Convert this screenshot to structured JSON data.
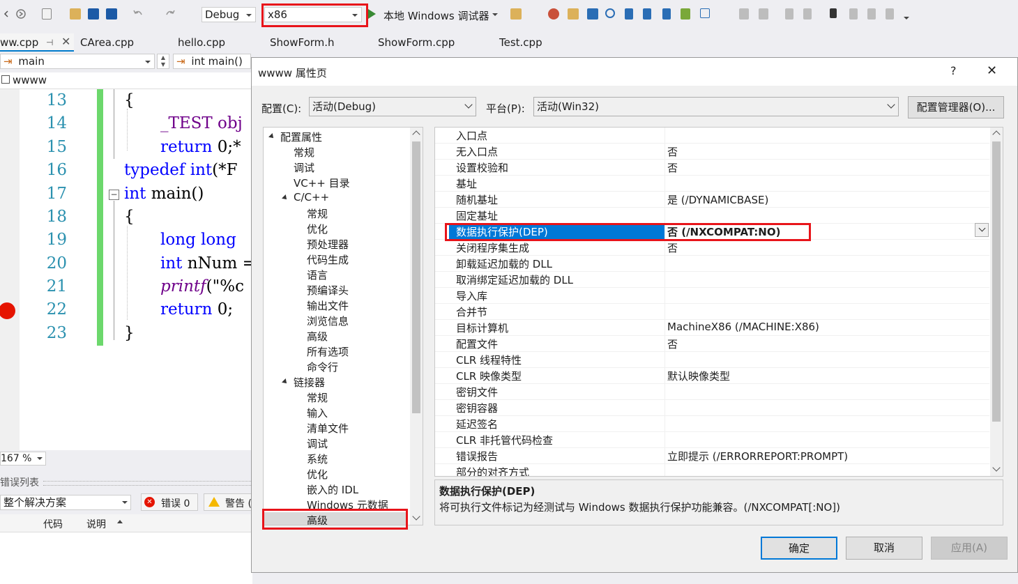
{
  "toolbar": {
    "config_value": "Debug",
    "platform_value": "x86",
    "debugger_label": "本地 Windows 调试器"
  },
  "tabs": [
    "ww.cpp",
    "CArea.cpp",
    "hello.cpp",
    "ShowForm.h",
    "ShowForm.cpp",
    "Test.cpp"
  ],
  "navbar": {
    "scope": "main",
    "member": "int main()"
  },
  "project_label": "wwww",
  "editor": {
    "line_numbers": [
      "13",
      "14",
      "15",
      "16",
      "17",
      "18",
      "19",
      "20",
      "21",
      "22",
      "23"
    ],
    "lines": {
      "l13": "{",
      "l14": "_TEST obj",
      "l15a": "return ",
      "l15b": "0;*",
      "l16a": "typedef ",
      "l16b": "int",
      "l16c": "(*F",
      "l17a": "int ",
      "l17b": "main()",
      "l18": "{",
      "l19": "long long",
      "l20a": "int ",
      "l20b": "nNum =",
      "l21a": "printf",
      "l21b": "(\"%c",
      "l22a": "return ",
      "l22b": "0;",
      "l23": "}"
    },
    "zoom": "167 %"
  },
  "error_list": {
    "title": "错误列表",
    "scope": "整个解决方案",
    "errors_label": "错误 0",
    "warnings_label": "警告 (",
    "col_code": "代码",
    "col_desc": "说明"
  },
  "dialog": {
    "title": "wwww 属性页",
    "help": "?",
    "config_label": "配置(C):",
    "config_value": "活动(Debug)",
    "platform_label": "平台(P):",
    "platform_value": "活动(Win32)",
    "config_manager": "配置管理器(O)...",
    "tree": [
      {
        "label": "配置属性",
        "level": 0,
        "expanded": true
      },
      {
        "label": "常规",
        "level": 1
      },
      {
        "label": "调试",
        "level": 1
      },
      {
        "label": "VC++ 目录",
        "level": 1
      },
      {
        "label": "C/C++",
        "level": 1,
        "expanded": true
      },
      {
        "label": "常规",
        "level": 2
      },
      {
        "label": "优化",
        "level": 2
      },
      {
        "label": "预处理器",
        "level": 2
      },
      {
        "label": "代码生成",
        "level": 2
      },
      {
        "label": "语言",
        "level": 2
      },
      {
        "label": "预编译头",
        "level": 2
      },
      {
        "label": "输出文件",
        "level": 2
      },
      {
        "label": "浏览信息",
        "level": 2
      },
      {
        "label": "高级",
        "level": 2
      },
      {
        "label": "所有选项",
        "level": 2
      },
      {
        "label": "命令行",
        "level": 2
      },
      {
        "label": "链接器",
        "level": 1,
        "expanded": true
      },
      {
        "label": "常规",
        "level": 2
      },
      {
        "label": "输入",
        "level": 2
      },
      {
        "label": "清单文件",
        "level": 2
      },
      {
        "label": "调试",
        "level": 2
      },
      {
        "label": "系统",
        "level": 2
      },
      {
        "label": "优化",
        "level": 2
      },
      {
        "label": "嵌入的 IDL",
        "level": 2
      },
      {
        "label": "Windows 元数据",
        "level": 2
      },
      {
        "label": "高级",
        "level": 2,
        "selected": true
      }
    ],
    "properties": [
      {
        "name": "入口点",
        "value": ""
      },
      {
        "name": "无入口点",
        "value": "否"
      },
      {
        "name": "设置校验和",
        "value": "否"
      },
      {
        "name": "基址",
        "value": ""
      },
      {
        "name": "随机基址",
        "value": "是 (/DYNAMICBASE)"
      },
      {
        "name": "固定基址",
        "value": ""
      },
      {
        "name": "数据执行保护(DEP)",
        "value": "否 (/NXCOMPAT:NO)",
        "selected": true
      },
      {
        "name": "关闭程序集生成",
        "value": "否"
      },
      {
        "name": "卸载延迟加载的 DLL",
        "value": ""
      },
      {
        "name": "取消绑定延迟加载的 DLL",
        "value": ""
      },
      {
        "name": "导入库",
        "value": ""
      },
      {
        "name": "合并节",
        "value": ""
      },
      {
        "name": "目标计算机",
        "value": "MachineX86 (/MACHINE:X86)"
      },
      {
        "name": "配置文件",
        "value": "否"
      },
      {
        "name": "CLR 线程特性",
        "value": ""
      },
      {
        "name": "CLR 映像类型",
        "value": "默认映像类型"
      },
      {
        "name": "密钥文件",
        "value": ""
      },
      {
        "name": "密钥容器",
        "value": ""
      },
      {
        "name": "延迟签名",
        "value": ""
      },
      {
        "name": "CLR 非托管代码检查",
        "value": ""
      },
      {
        "name": "错误报告",
        "value": "立即提示 (/ERRORREPORT:PROMPT)"
      },
      {
        "name": "部分的对齐方式",
        "value": ""
      }
    ],
    "desc_title": "数据执行保护(DEP)",
    "desc_text": "将可执行文件标记为经测试与 Windows 数据执行保护功能兼容。(/NXCOMPAT[:NO])",
    "ok": "确定",
    "cancel": "取消",
    "apply": "应用(A)"
  },
  "colors": {
    "selection": "#0078d7",
    "highlight_box": "#e8141a",
    "breakpoint": "#e51400",
    "change_bar": "#6cd86c"
  }
}
